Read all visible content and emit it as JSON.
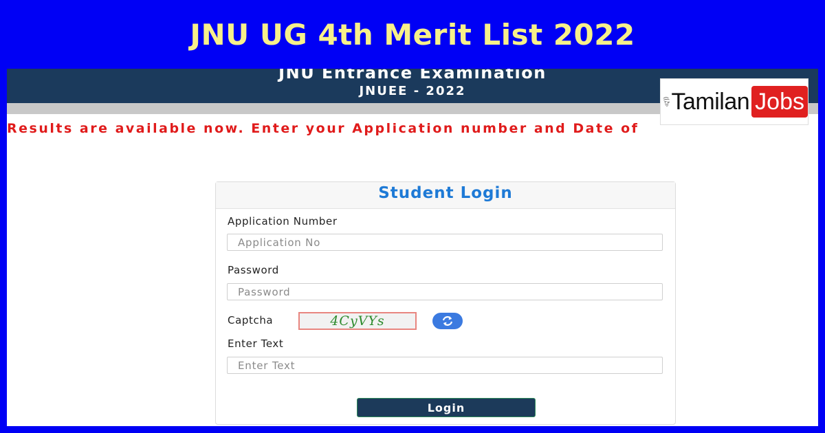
{
  "banner": {
    "title": "JNU UG 4th Merit List 2022"
  },
  "site": {
    "title": "JNU Entrance Examination",
    "subtitle": "JNUEE - 2022",
    "marquee": "Results are available now. Enter your Application number and Date of"
  },
  "logo": {
    "word1": "Tamilan",
    "word2": "Jobs",
    "accent": "#e02020"
  },
  "login": {
    "heading": "Student Login",
    "app_label": "Application Number",
    "app_placeholder": "Application No",
    "password_label": "Password",
    "password_placeholder": "Password",
    "captcha_label": "Captcha",
    "captcha_text": "4CyVYs",
    "enter_text_label": "Enter Text",
    "enter_text_placeholder": "Enter Text",
    "submit": "Login"
  },
  "colors": {
    "banner_bg": "#0000f5",
    "banner_text": "#f7f08a",
    "header_bg": "#1b3a5c",
    "marquee_text": "#e01b1b",
    "heading_text": "#1e7ad6",
    "button_bg": "#1c3a5a"
  }
}
